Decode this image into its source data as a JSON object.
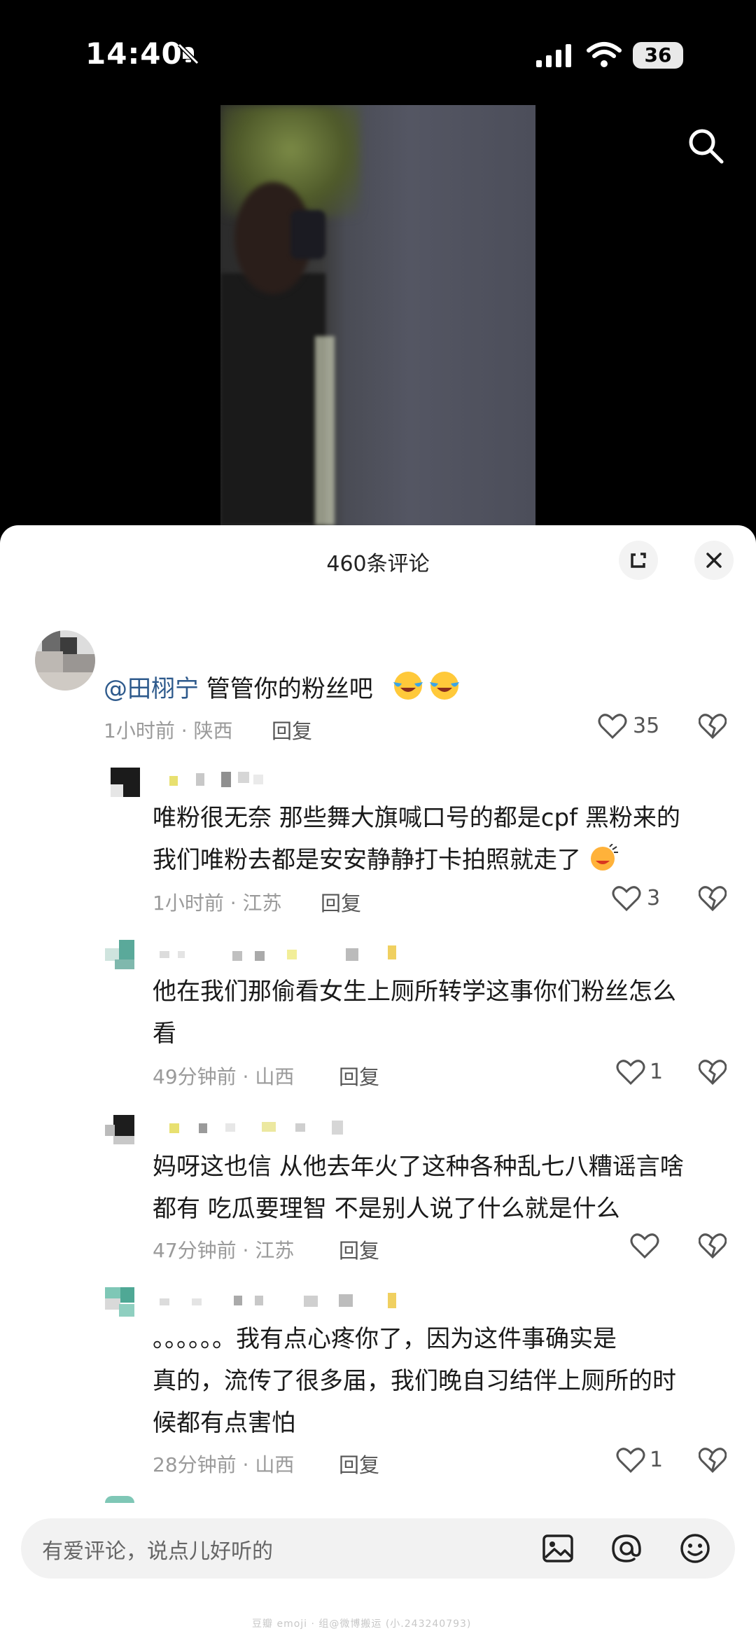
{
  "status_bar": {
    "time": "14:40",
    "battery": "36"
  },
  "video": {
    "search_icon": "search-icon"
  },
  "sheet": {
    "title": "460条评论"
  },
  "comments": [
    {
      "mention": "@田栩宁",
      "text": " 管管你的粉丝吧",
      "meta": "1小时前 · 陕西",
      "reply": "回复",
      "likes": "35"
    },
    {
      "text_lines": [
        "唯粉很无奈  那些舞大旗喊口号的都是cpf 黑粉来的",
        "我们唯粉去都是安安静静打卡拍照就走了"
      ],
      "meta": "1小时前 · 江苏",
      "reply": "回复",
      "likes": "3"
    },
    {
      "text_lines": [
        "他在我们那偷看女生上厕所转学这事你们粉丝怎么",
        "看"
      ],
      "meta": "49分钟前 · 山西",
      "reply": "回复",
      "likes": "1"
    },
    {
      "text_lines": [
        "妈呀这也信 从他去年火了这种各种乱七八糟谣言啥",
        "都有 吃瓜要理智 不是别人说了什么就是什么"
      ],
      "meta": "47分钟前 · 江苏",
      "reply": "回复",
      "likes": ""
    },
    {
      "text_lines": [
        "。。。。。。我有点心疼你了，因为这件事确实是",
        "真的，流传了很多届，我们晚自习结伴上厕所的时",
        "候都有点害怕"
      ],
      "meta": "28分钟前 · 山西",
      "reply": "回复",
      "likes": "1"
    }
  ],
  "input": {
    "placeholder": "有爱评论，说点儿好听的"
  },
  "watermark": "豆瓣  emoji  · 组@微博搬运 (小.243240793)"
}
